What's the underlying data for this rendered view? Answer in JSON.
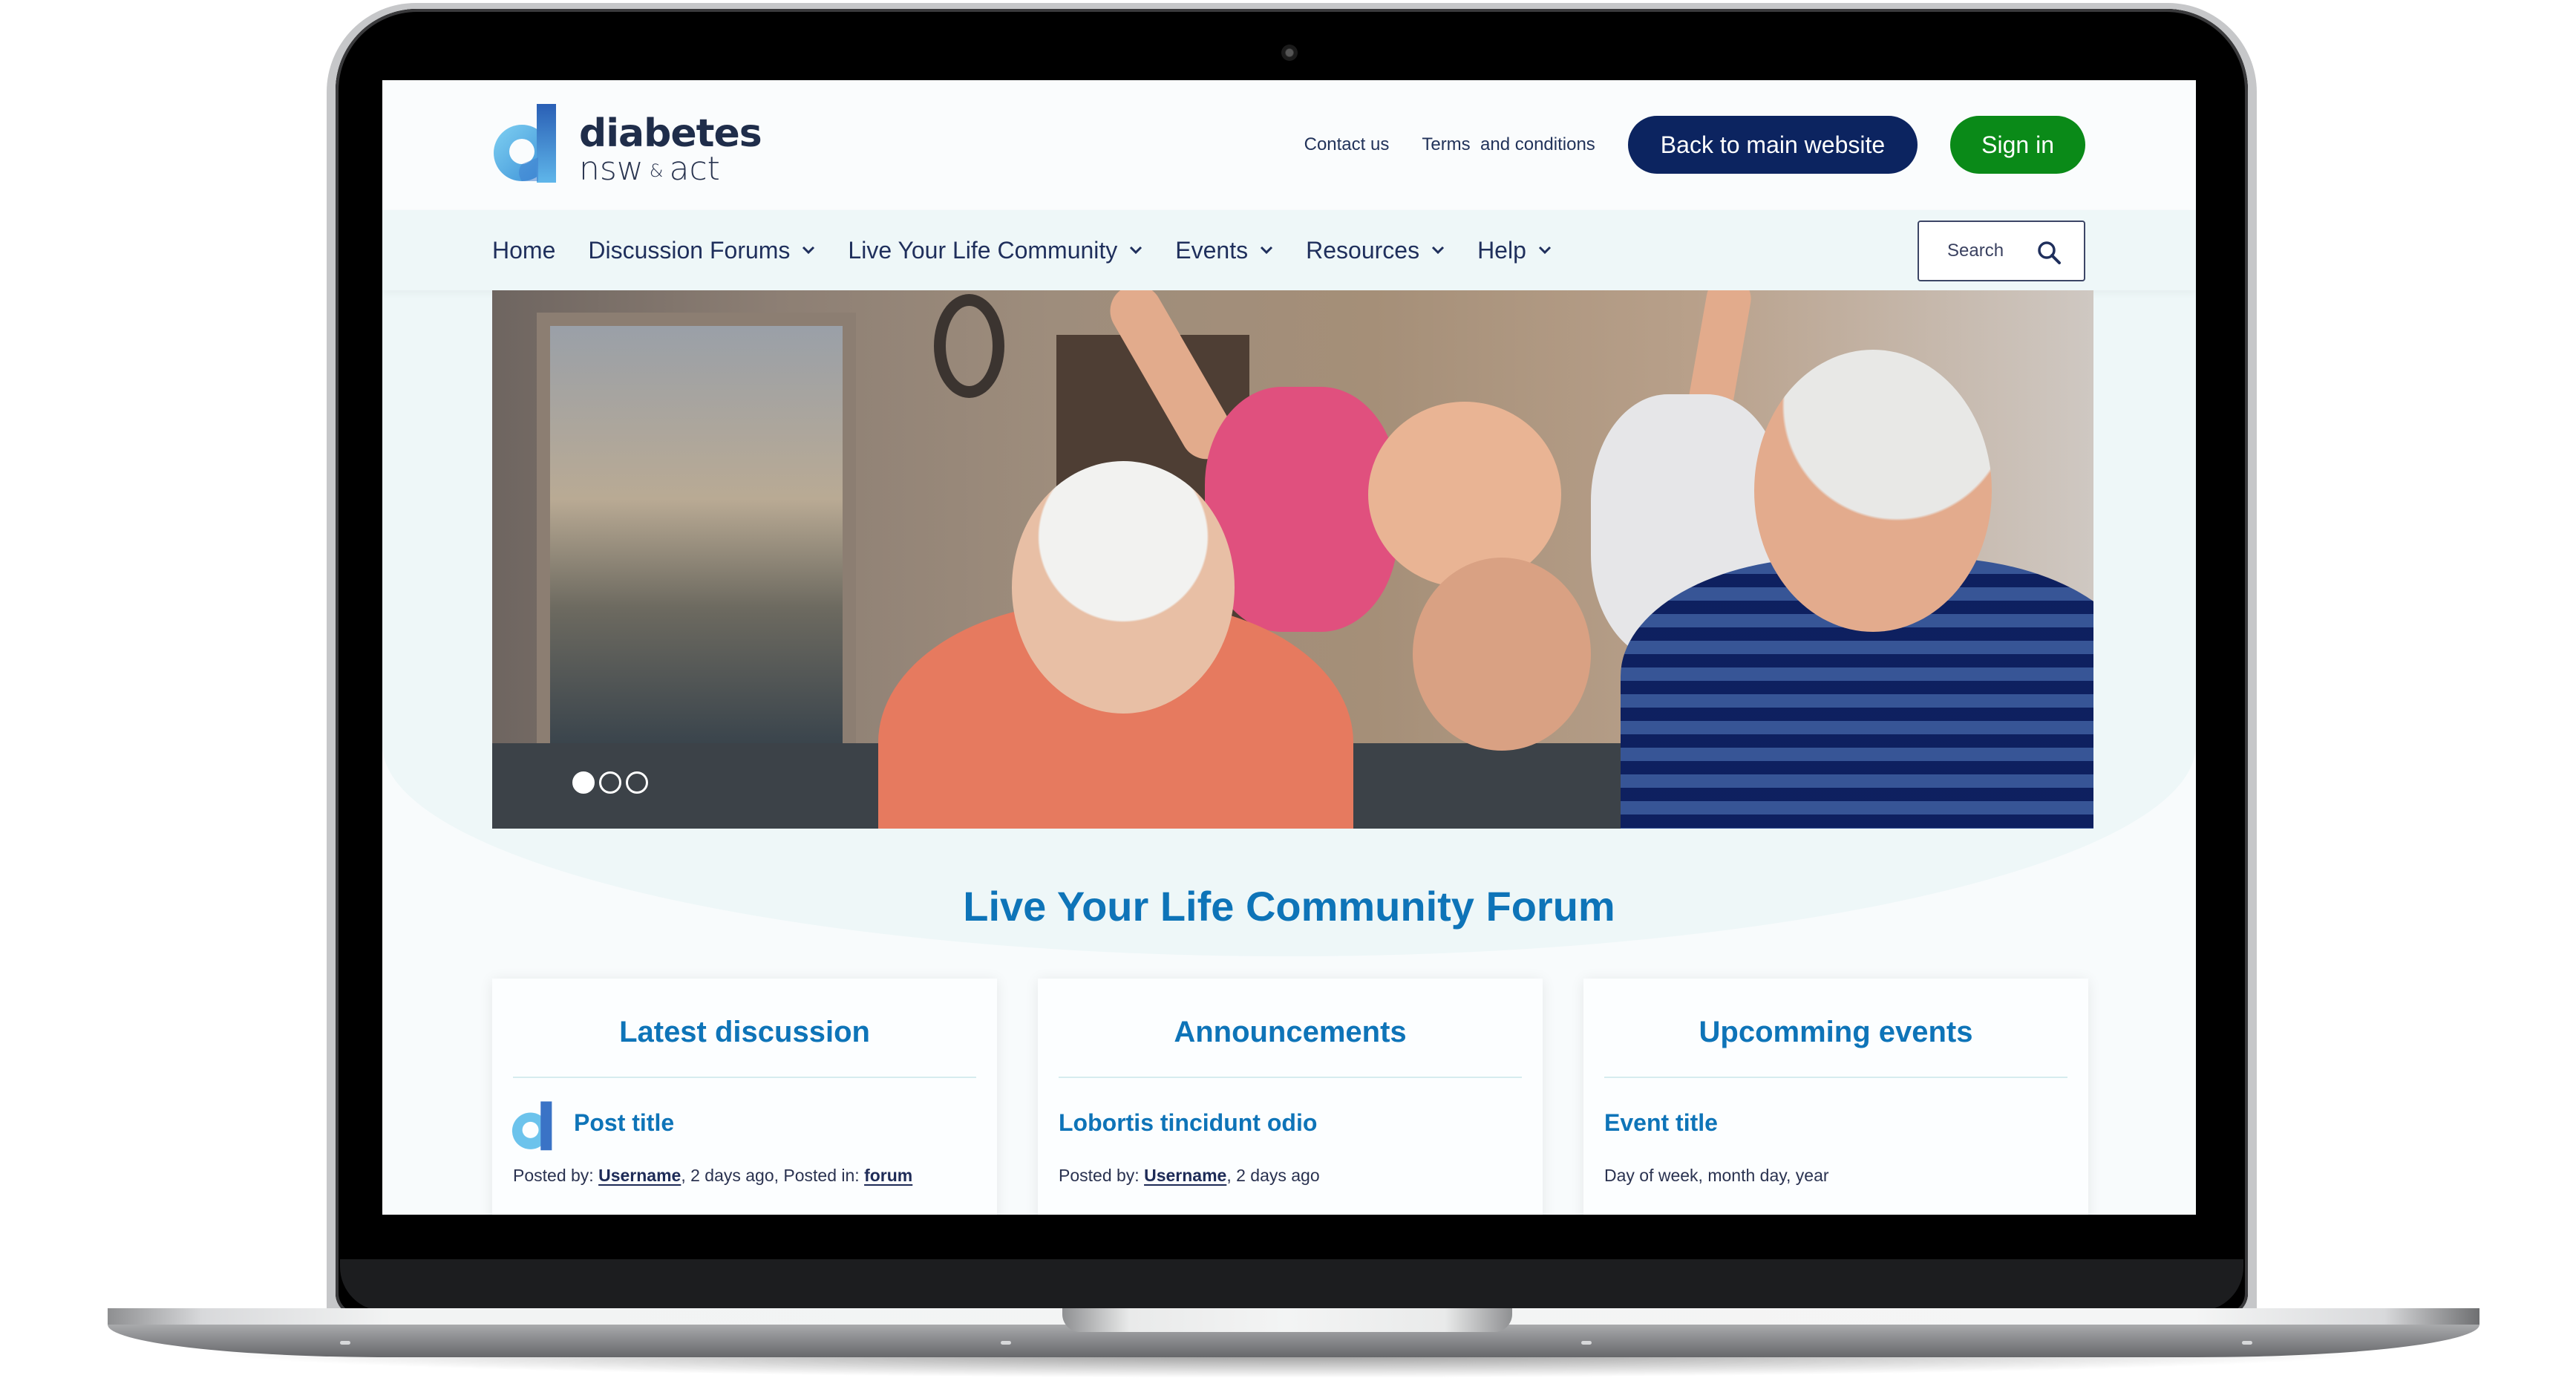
{
  "device": "laptop",
  "site": {
    "logo": {
      "line1": "diabetes",
      "line2_a": "nsw",
      "line2_amp": "&",
      "line2_b": "act",
      "colors": {
        "light": "#6cc3ec",
        "dark": "#2a5fb5",
        "text": "#1f2d4a"
      }
    },
    "header": {
      "links": [
        "Contact us",
        "Terms  and conditions"
      ],
      "back_button": "Back to main website",
      "signin_button": "Sign in",
      "colors": {
        "back_button_bg": "#0c2460",
        "signin_bg": "#0a8a18"
      }
    },
    "nav": {
      "items": [
        {
          "label": "Home",
          "has_dropdown": false
        },
        {
          "label": "Discussion Forums",
          "has_dropdown": true
        },
        {
          "label": "Live Your Life Community",
          "has_dropdown": true
        },
        {
          "label": "Events",
          "has_dropdown": true
        },
        {
          "label": "Resources",
          "has_dropdown": true
        },
        {
          "label": "Help",
          "has_dropdown": true
        }
      ],
      "search_placeholder": "Search"
    },
    "hero": {
      "image_description": "Grandparents playing with two laughing children outside a house",
      "slides_total": 3,
      "active_slide": 1
    },
    "forum_title": "Live Your Life Community Forum",
    "accent_color": "#0e74b8",
    "cards": [
      {
        "heading": "Latest discussion",
        "item_title": "Post title",
        "meta_prefix": "Posted by: ",
        "meta_user": "Username",
        "meta_middle": ", 2 days ago, Posted in: ",
        "meta_link": "forum",
        "has_avatar": true
      },
      {
        "heading": "Announcements",
        "item_title": "Lobortis tincidunt odio",
        "meta_prefix": "Posted by: ",
        "meta_user": "Username",
        "meta_middle": ", 2 days ago",
        "meta_link": ""
      },
      {
        "heading": "Upcomming events",
        "item_title": "Event title",
        "meta_text": "Day of week, month day, year"
      }
    ]
  }
}
